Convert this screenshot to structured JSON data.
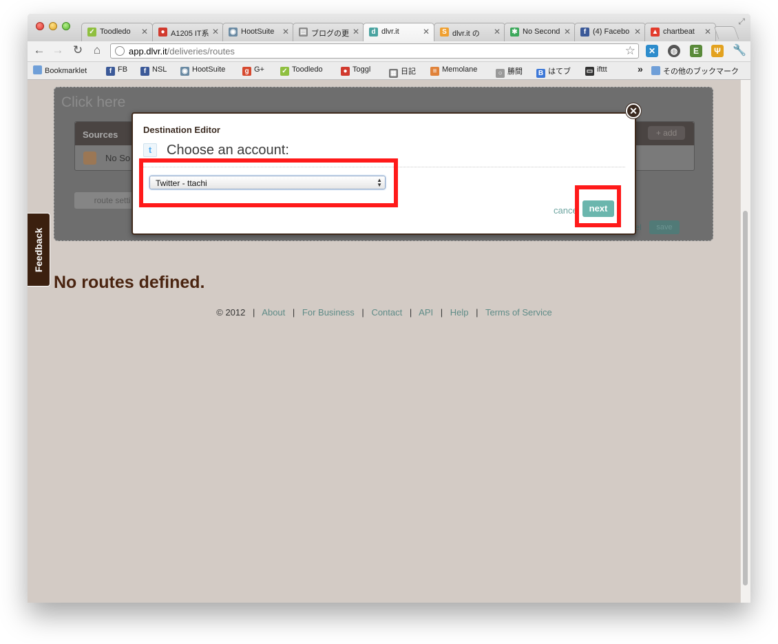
{
  "browser": {
    "tabs": [
      {
        "title": "Toodledo",
        "icon_color": "#8fbf3f",
        "glyph": "✓"
      },
      {
        "title": "A1205 IT系",
        "icon_color": "#d13a2e",
        "glyph": "●"
      },
      {
        "title": "HootSuite",
        "icon_color": "#6a8aa3",
        "glyph": "◉"
      },
      {
        "title": "ブログの更",
        "icon_color": "#888888",
        "glyph": "▤"
      },
      {
        "title": "dlvr.it",
        "icon_color": "#4aa3a0",
        "glyph": "d"
      },
      {
        "title": "dlvr.it の",
        "icon_color": "#f0a030",
        "glyph": "S"
      },
      {
        "title": "No Second",
        "icon_color": "#3ba85a",
        "glyph": "✱"
      },
      {
        "title": "(4) Facebo",
        "icon_color": "#3b5998",
        "glyph": "f"
      },
      {
        "title": "chartbeat",
        "icon_color": "#e23b2c",
        "glyph": "▲"
      }
    ],
    "tab_close_glyph": "✕",
    "url_host": "app.dlvr.it",
    "url_path": "/deliveries/routes",
    "bookmarks": [
      {
        "label": "Bookmarklet",
        "icon_color": "#6f9fd8",
        "glyph": ""
      },
      {
        "label": "FB",
        "icon_color": "#3b5998",
        "glyph": "f"
      },
      {
        "label": "NSL",
        "icon_color": "#3b5998",
        "glyph": "f"
      },
      {
        "label": "HootSuite",
        "icon_color": "#6a8aa3",
        "glyph": "◉"
      },
      {
        "label": "G+",
        "icon_color": "#d6492f",
        "glyph": "g"
      },
      {
        "label": "Toodledo",
        "icon_color": "#8fbf3f",
        "glyph": "✓"
      },
      {
        "label": "Toggl",
        "icon_color": "#d13a2e",
        "glyph": "●"
      },
      {
        "label": "日記",
        "icon_color": "#777777",
        "glyph": "▦"
      },
      {
        "label": "Memolane",
        "icon_color": "#e0823a",
        "glyph": "≡"
      },
      {
        "label": "勝間",
        "icon_color": "#999999",
        "glyph": "○"
      },
      {
        "label": "はてブ",
        "icon_color": "#3d78d8",
        "glyph": "B"
      },
      {
        "label": "ifttt",
        "icon_color": "#333333",
        "glyph": "▭"
      }
    ],
    "bookmarks_more": "»",
    "bookmarks_other": "その他のブックマーク"
  },
  "page": {
    "click_here": "Click here",
    "sources_label": "Sources",
    "add_label": "+ add",
    "no_sources": "No So",
    "route_settings": "route setti",
    "panel_cancel": "cancel",
    "panel_save": "save",
    "feedback": "Feedback",
    "no_routes": "No routes defined.",
    "footer": {
      "copyright": "© 2012",
      "links": [
        "About",
        "For Business",
        "Contact",
        "API",
        "Help",
        "Terms of Service"
      ]
    }
  },
  "modal": {
    "title": "Destination Editor",
    "heading": "Choose an account:",
    "selected_account": "Twitter - ttachi",
    "cancel": "cancel",
    "next": "next",
    "close_glyph": "✕"
  },
  "colors": {
    "page_bg": "#d3cbc5",
    "highlight": "#ff1a1a",
    "accent_teal": "#6bb6ad",
    "brand_brown": "#3b200f"
  }
}
